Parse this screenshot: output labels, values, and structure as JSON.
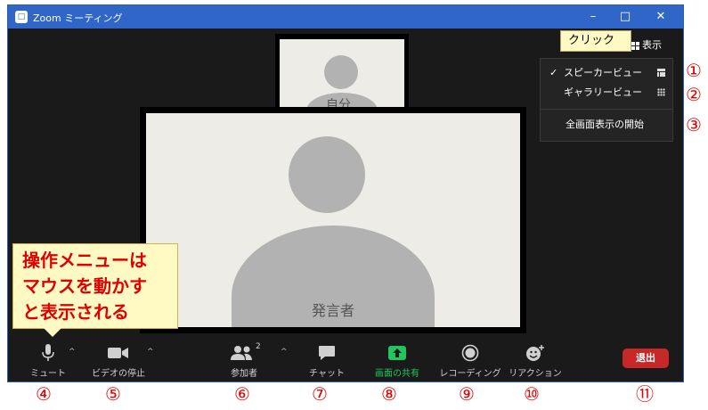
{
  "window": {
    "title": "Zoom ミーティング",
    "logo_glyph": "□",
    "minimize": "–",
    "maximize": "□",
    "close": "✕"
  },
  "self_video": {
    "name": "自分"
  },
  "speaker_video": {
    "name": "発言者"
  },
  "view_button": {
    "label": "表示"
  },
  "callouts": {
    "click": "クリック",
    "operation_lines": [
      "操作メニューは",
      "マウスを動かす",
      "と表示される"
    ]
  },
  "view_menu": {
    "items": [
      {
        "check": "✓",
        "label": "スピーカービュー",
        "icon": "speaker-view-icon"
      },
      {
        "check": "",
        "label": "ギャラリービュー",
        "icon": "gallery-view-icon"
      },
      {
        "check": "",
        "label": "全画面表示の開始",
        "icon": ""
      }
    ]
  },
  "toolbar": {
    "mute": "ミュート",
    "stop_video": "ビデオの停止",
    "participants": "参加者",
    "participants_count": "2",
    "chat": "チャット",
    "share_screen": "画面の共有",
    "recording": "レコーディング",
    "reactions": "リアクション",
    "caret": "^",
    "exit": "退出"
  },
  "markers": [
    "①",
    "②",
    "③",
    "④",
    "⑤",
    "⑥",
    "⑦",
    "⑧",
    "⑨",
    "⑩",
    "⑪"
  ],
  "colors": {
    "title_bar": "#2f66c7",
    "share_green": "#22c55e",
    "exit_red": "#c62828",
    "annotation_red": "#e00000",
    "callout_yellow": "#fff9c4"
  }
}
